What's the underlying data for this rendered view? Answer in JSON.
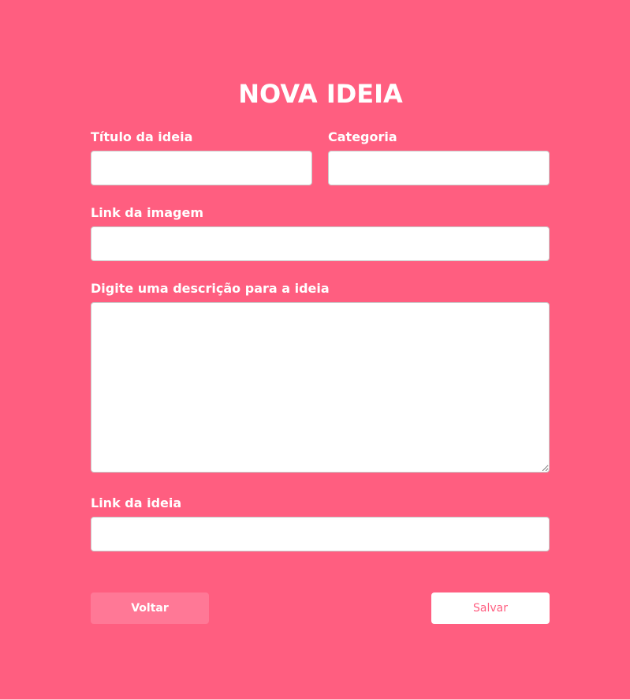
{
  "form": {
    "title": "NOVA IDEIA",
    "fields": {
      "titulo": {
        "label": "Título da ideia",
        "value": ""
      },
      "categoria": {
        "label": "Categoria",
        "value": ""
      },
      "link_imagem": {
        "label": "Link da imagem",
        "value": ""
      },
      "descricao": {
        "label": "Digite uma descrição para a ideia",
        "value": ""
      },
      "link_ideia": {
        "label": "Link da ideia",
        "value": ""
      }
    },
    "buttons": {
      "back_label": "Voltar",
      "save_label": "Salvar"
    }
  },
  "colors": {
    "background": "#ff5e80",
    "back_button": "#ff7896",
    "save_button_text": "#ff5e80"
  }
}
